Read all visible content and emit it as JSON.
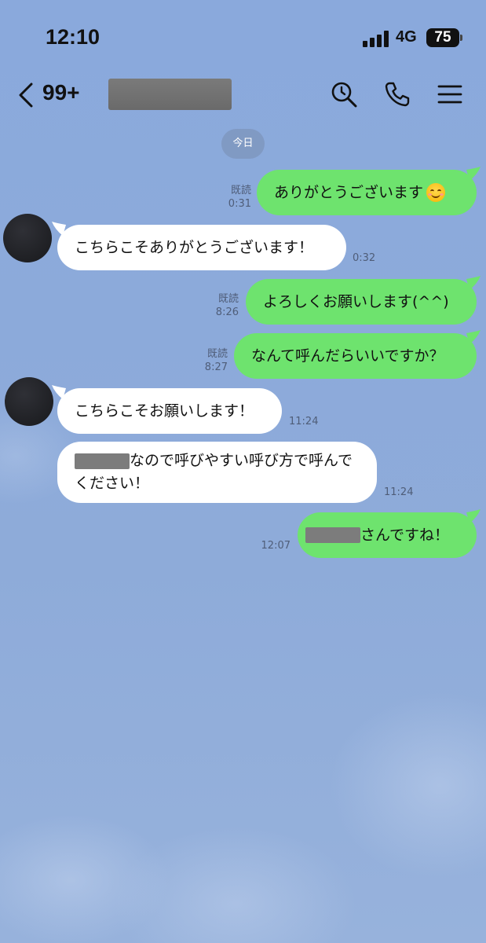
{
  "status_bar": {
    "time": "12:10",
    "network": "4G",
    "battery": "75"
  },
  "header": {
    "unread_count": "99+"
  },
  "date_label": "今日",
  "messages": [
    {
      "side": "mine",
      "text": "ありがとうございます",
      "emoji": "smiling-face",
      "read": "既読",
      "time": "0:31"
    },
    {
      "side": "theirs",
      "text": "こちらこそありがとうございます！",
      "time": "0:32"
    },
    {
      "side": "mine",
      "text": "よろしくお願いします(^^)",
      "read": "既読",
      "time": "8:26"
    },
    {
      "side": "mine",
      "text": "なんて呼んだらいいですか？",
      "read": "既読",
      "time": "8:27"
    },
    {
      "side": "theirs",
      "text": "こちらこそお願いします！",
      "time": "11:24"
    },
    {
      "side": "theirs",
      "text_after_redaction_line1": "なので呼びやすい呼び方で呼んで",
      "text_line2": "ください！",
      "time": "11:24"
    },
    {
      "side": "mine",
      "text_after_redaction": "さんですね！",
      "time": "12:07"
    }
  ]
}
